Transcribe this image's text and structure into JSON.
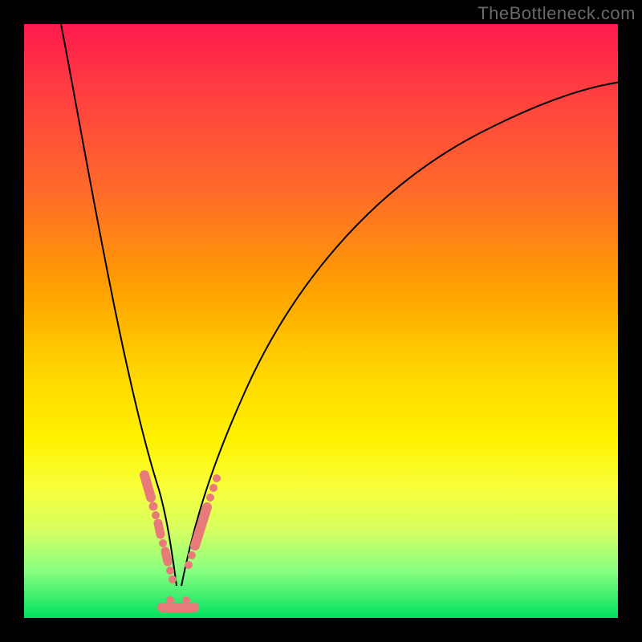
{
  "watermark": "TheBottleneck.com",
  "colors": {
    "frame": "#000000",
    "gradient_top": "#ff1a4d",
    "gradient_bottom": "#00e060",
    "curve": "#000000",
    "marker": "#e97a7a"
  },
  "chart_data": {
    "type": "line",
    "title": "",
    "xlabel": "",
    "ylabel": "",
    "xlim": [
      0,
      100
    ],
    "ylim": [
      0,
      100
    ],
    "x_min_point": 25,
    "series": [
      {
        "name": "bottleneck-curve",
        "x": [
          0,
          2,
          4,
          6,
          8,
          10,
          12,
          14,
          16,
          18,
          20,
          22,
          24,
          25,
          26,
          28,
          30,
          32,
          34,
          36,
          38,
          40,
          45,
          50,
          55,
          60,
          65,
          70,
          75,
          80,
          85,
          90,
          95,
          100
        ],
        "y": [
          100,
          91,
          82,
          73,
          65,
          56,
          48,
          40,
          32,
          24,
          17,
          10,
          4,
          0,
          3,
          9,
          15,
          21,
          27,
          33,
          38,
          43,
          53,
          61,
          67,
          72,
          76,
          79,
          82,
          84,
          86,
          87,
          88,
          89
        ]
      }
    ],
    "markers": {
      "left_branch": [
        {
          "x": 18.8,
          "y": 22.5
        },
        {
          "x": 19.4,
          "y": 20.0
        },
        {
          "x": 20.0,
          "y": 17.5
        },
        {
          "x": 20.7,
          "y": 15.0
        },
        {
          "x": 21.3,
          "y": 12.5
        },
        {
          "x": 21.9,
          "y": 10.3
        },
        {
          "x": 22.6,
          "y": 8.0
        },
        {
          "x": 23.2,
          "y": 5.7
        },
        {
          "x": 23.8,
          "y": 3.5
        }
      ],
      "right_branch": [
        {
          "x": 27.0,
          "y": 6.0
        },
        {
          "x": 27.8,
          "y": 8.5
        },
        {
          "x": 28.6,
          "y": 11.0
        },
        {
          "x": 29.4,
          "y": 13.5
        },
        {
          "x": 30.2,
          "y": 16.0
        },
        {
          "x": 31.0,
          "y": 18.5
        },
        {
          "x": 31.8,
          "y": 21.0
        }
      ],
      "bottom_band": {
        "x_start": 22.5,
        "x_end": 27.5,
        "y": 1.0
      }
    }
  }
}
